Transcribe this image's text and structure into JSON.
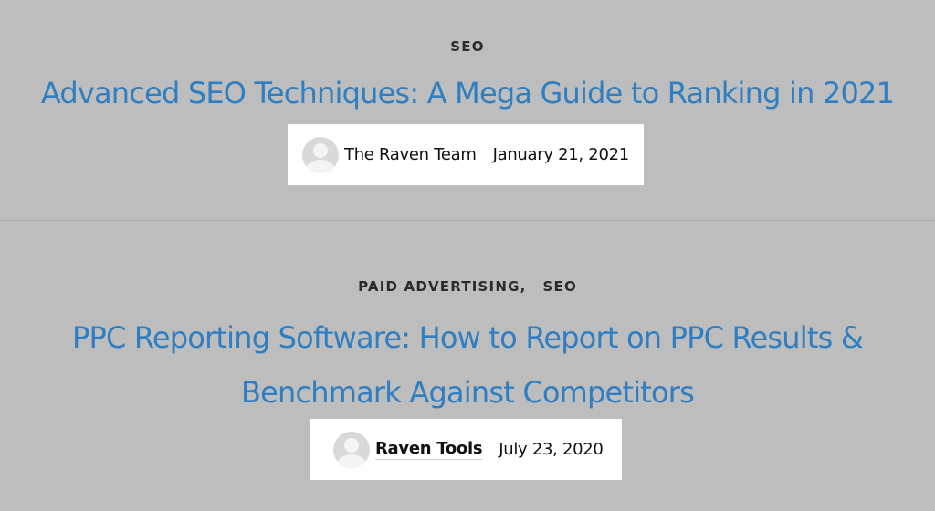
{
  "posts": [
    {
      "categories": [
        "SEO"
      ],
      "title": "Advanced SEO Techniques: A Mega Guide to Ranking in 2021",
      "author": "The Raven Team",
      "date": "January 21, 2021"
    },
    {
      "categories": [
        "PAID ADVERTISING",
        "SEO"
      ],
      "category_separator": ",",
      "title_line1": "PPC Reporting Software: How to Report on PPC Results &",
      "title_line2": "Benchmark Against Competitors",
      "author": "Raven Tools",
      "date": "July 23, 2020"
    }
  ],
  "colors": {
    "background": "#bdbdbd",
    "title_link": "#2f7ec1",
    "category_text": "#2b2b2b",
    "meta_box": "#ffffff"
  },
  "icons": {
    "avatar": "default-user-avatar-icon"
  }
}
